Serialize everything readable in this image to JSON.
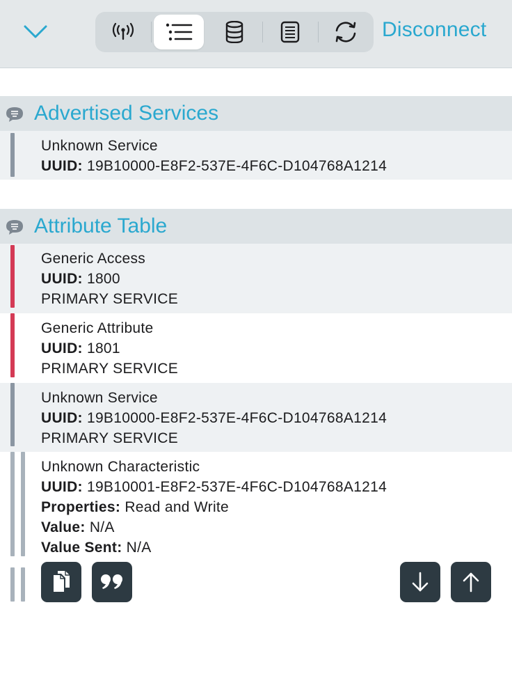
{
  "toolbar": {
    "disconnect_label": "Disconnect",
    "segments": [
      "antenna-icon",
      "list-icon",
      "database-icon",
      "log-icon",
      "refresh-icon"
    ],
    "active_segment": "list-icon"
  },
  "advertised": {
    "title": "Advertised Services",
    "item": {
      "name": "Unknown Service",
      "uuid_label": "UUID:",
      "uuid": "19B10000-E8F2-537E-4F6C-D104768A1214"
    }
  },
  "attributes": {
    "title": "Attribute Table",
    "items": [
      {
        "name": "Generic Access",
        "uuid_label": "UUID:",
        "uuid": "1800",
        "kind": "PRIMARY SERVICE",
        "color": "#d43a55"
      },
      {
        "name": "Generic Attribute",
        "uuid_label": "UUID:",
        "uuid": "1801",
        "kind": "PRIMARY SERVICE",
        "color": "#d43a55"
      },
      {
        "name": "Unknown Service",
        "uuid_label": "UUID:",
        "uuid": "19B10000-E8F2-537E-4F6C-D104768A1214",
        "kind": "PRIMARY SERVICE",
        "color": "#8b96a2"
      }
    ],
    "characteristic": {
      "name": "Unknown Characteristic",
      "uuid_label": "UUID:",
      "uuid": "19B10001-E8F2-537E-4F6C-D104768A1214",
      "properties_label": "Properties:",
      "properties": "Read and Write",
      "value_label": "Value:",
      "value": "N/A",
      "value_sent_label": "Value Sent:",
      "value_sent": "N/A"
    }
  },
  "actions": [
    "copy-icon",
    "quote-icon",
    "arrow-down-icon",
    "arrow-up-icon"
  ],
  "colors": {
    "accent": "#2aa8cf",
    "button": "#2d3a42",
    "header_bg": "#dde3e6"
  }
}
